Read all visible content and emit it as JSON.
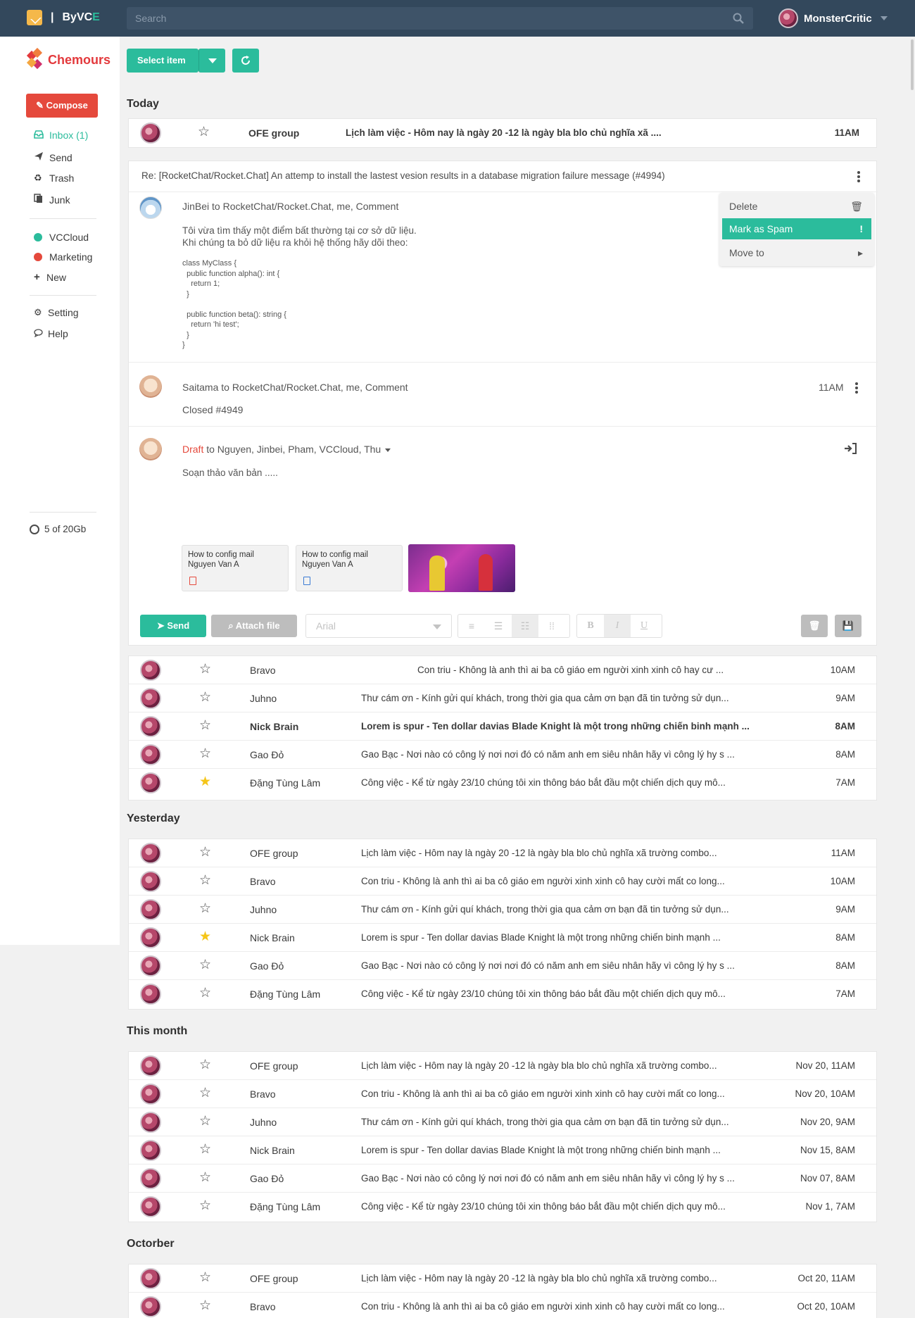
{
  "header": {
    "brand_sep": "|",
    "brand_prefix": "By",
    "brand_name": "VC",
    "brand_accent": "E",
    "search_placeholder": "Search",
    "username": "MonsterCritic"
  },
  "sidebar": {
    "logo_text": "Chemours",
    "compose_label": "Compose",
    "items": [
      {
        "label": "Inbox (1)",
        "icon": "inbox-icon",
        "active": true
      },
      {
        "label": "Send",
        "icon": "send-icon"
      },
      {
        "label": "Trash",
        "icon": "trash-icon"
      },
      {
        "label": "Junk",
        "icon": "junk-icon"
      }
    ],
    "labels": [
      {
        "label": "VCCloud",
        "color": "#2bbc9c"
      },
      {
        "label": "Marketing",
        "color": "#e5493c"
      },
      {
        "label": "New",
        "icon": "plus-icon"
      }
    ],
    "settings": [
      {
        "label": "Setting",
        "icon": "gear-icon"
      },
      {
        "label": "Help",
        "icon": "chat-icon"
      }
    ],
    "storage": "5 of 20Gb"
  },
  "toolbar": {
    "select_label": "Select item"
  },
  "sections": {
    "today": "Today",
    "yesterday": "Yesterday",
    "this_month": "This month",
    "october": "Octorber"
  },
  "today_top": {
    "from": "OFE group",
    "subject": "Lịch làm việc - Hôm nay là ngày  20 -12 là ngày bla blo chủ nghĩa xã ....",
    "time": "11AM"
  },
  "thread": {
    "subject": "Re: [RocketChat/Rocket.Chat] An attemp to install the lastest vesion results in a database migration failure message (#4994)",
    "msg1": {
      "header": "JinBei to RocketChat/Rocket.Chat, me, Comment",
      "line1": "Tôi vừa tìm thấy một điểm bất thường tại cơ sở dữ liệu.",
      "line2": "Khi chúng ta bỏ dữ liệu ra khỏi hệ thống hãy dõi theo:",
      "code": "class MyClass {\n  public function alpha(): int {\n    return 1;\n  }\n\n  public function beta(): string {\n    return 'hi test';\n  }\n}"
    },
    "menu": {
      "delete": "Delete",
      "spam": "Mark as Spam",
      "spam_mark": "!",
      "move": "Move to"
    },
    "msg2": {
      "header": "Saitama to RocketChat/Rocket.Chat, me, Comment",
      "body": "Closed #4949",
      "time": "11AM"
    },
    "draft": {
      "draft_label": "Draft",
      "recipients": " to Nguyen, Jinbei, Pham, VCCloud, Thu",
      "body": "Soạn thảo văn bản .....",
      "attachments": [
        {
          "title": "How to config mail",
          "author": "Nguyen Van A",
          "icon": "pdf-icon",
          "color": "#e5493c"
        },
        {
          "title": "How to config mail",
          "author": "Nguyen Van A",
          "icon": "doc-icon",
          "color": "#3b7bd4"
        }
      ]
    },
    "editor": {
      "send": "Send",
      "attach": "Attach file",
      "font": "Arial",
      "bold": "B",
      "italic": "I",
      "underline": "U"
    }
  },
  "today_rows": [
    {
      "from": "Bravo",
      "subject": "Con triu - Không là anh thì ai ba cô giáo em người xinh xinh cô hay cư ...",
      "time": "10AM",
      "starred": false,
      "bold": false
    },
    {
      "from": "Juhno",
      "subject": "Thư cám ơn - Kính gửi quí khách, trong thời gia qua cảm ơn bạn đã tin tưởng sử dụn...",
      "time": "9AM",
      "starred": false,
      "bold": false
    },
    {
      "from": "Nick Brain",
      "subject": "Lorem is spur - Ten dollar davias Blade Knight là một trong những chiến binh mạnh ...",
      "time": "8AM",
      "starred": false,
      "bold": true
    },
    {
      "from": "Gao Đỏ",
      "subject": "Gao Bạc - Nơi nào có công lý nơi nơi đó có năm anh em siêu nhân hãy vì công lý hy s ...",
      "time": "8AM",
      "starred": false,
      "bold": false
    },
    {
      "from": "Đặng Tùng Lâm",
      "subject": "Công việc - Kể từ ngày 23/10 chúng tôi xin thông báo bắt đầu một chiến dịch quy mô...",
      "time": "7AM",
      "starred": true,
      "bold": false
    }
  ],
  "yesterday_rows": [
    {
      "from": "OFE group",
      "subject": "Lịch làm việc - Hôm nay là ngày  20 -12 là ngày bla blo chủ nghĩa xã trường combo...",
      "time": "11AM",
      "starred": false
    },
    {
      "from": "Bravo",
      "subject": "Con triu - Không là anh thì ai ba cô giáo em người xinh xinh cô hay cười mất co long...",
      "time": "10AM",
      "starred": false
    },
    {
      "from": "Juhno",
      "subject": "Thư cám ơn - Kính gửi quí khách, trong thời gia qua cảm ơn bạn đã tin tưởng sử dụn...",
      "time": "9AM",
      "starred": false
    },
    {
      "from": "Nick Brain",
      "subject": "Lorem is spur - Ten dollar davias Blade Knight là một trong những chiến binh mạnh ...",
      "time": "8AM",
      "starred": true
    },
    {
      "from": "Gao Đỏ",
      "subject": "Gao Bạc - Nơi nào có công lý nơi nơi đó có năm anh em siêu nhân hãy vì công lý hy s ...",
      "time": "8AM",
      "starred": false
    },
    {
      "from": "Đặng Tùng Lâm",
      "subject": "Công việc - Kể từ ngày 23/10 chúng tôi xin thông báo bắt đầu một chiến dịch quy mô...",
      "time": "7AM",
      "starred": false
    }
  ],
  "month_rows": [
    {
      "from": "OFE group",
      "subject": "Lịch làm việc - Hôm nay là ngày  20 -12 là ngày bla blo chủ nghĩa xã trường combo...",
      "time": "Nov 20, 11AM",
      "starred": false
    },
    {
      "from": "Bravo",
      "subject": "Con triu - Không là anh thì ai ba cô giáo em người xinh xinh cô hay cười mất co long...",
      "time": "Nov 20, 10AM",
      "starred": false
    },
    {
      "from": "Juhno",
      "subject": "Thư cám ơn - Kính gửi quí khách, trong thời gia qua cảm ơn bạn đã tin tưởng sử dụn...",
      "time": "Nov 20, 9AM",
      "starred": false
    },
    {
      "from": "Nick Brain",
      "subject": "Lorem is spur - Ten dollar davias Blade Knight là một trong những chiến binh mạnh ...",
      "time": "Nov 15, 8AM",
      "starred": false
    },
    {
      "from": "Gao Đỏ",
      "subject": "Gao Bạc - Nơi nào có công lý nơi nơi đó có năm anh em siêu nhân hãy vì công lý hy s ...",
      "time": "Nov 07, 8AM",
      "starred": false
    },
    {
      "from": "Đặng Tùng Lâm",
      "subject": "Công việc - Kể từ ngày 23/10 chúng tôi xin thông báo bắt đầu một chiến dịch quy mô...",
      "time": "Nov 1, 7AM",
      "starred": false
    }
  ],
  "october_rows": [
    {
      "from": "OFE group",
      "subject": "Lịch làm việc - Hôm nay là ngày  20 -12 là ngày bla blo chủ nghĩa xã trường combo...",
      "time": "Oct 20, 11AM",
      "starred": false
    },
    {
      "from": "Bravo",
      "subject": "Con triu - Không là anh thì ai ba cô giáo em người xinh xinh cô hay cười mất co long...",
      "time": "Oct 20, 10AM",
      "starred": false
    }
  ]
}
